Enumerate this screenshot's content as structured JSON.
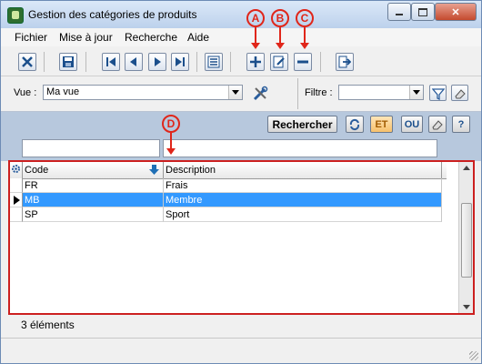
{
  "window": {
    "title": "Gestion des catégories de produits",
    "minimize_icon": "minimize-icon",
    "maximize_icon": "maximize-icon",
    "close_label": "✕"
  },
  "menu": {
    "items": [
      "Fichier",
      "Mise à jour",
      "Recherche",
      "Aide"
    ]
  },
  "toolbar": {
    "buttons": [
      "close-icon",
      "save-icon",
      "first-record-icon",
      "previous-record-icon",
      "next-record-icon",
      "last-record-icon",
      "list-icon",
      "add-icon",
      "edit-icon",
      "delete-icon",
      "export-icon"
    ]
  },
  "annotations": {
    "a": "A",
    "b": "B",
    "c": "C",
    "d": "D",
    "color": "#e0261a"
  },
  "view": {
    "label": "Vue :",
    "value": "Ma vue",
    "filter_label": "Filtre :",
    "filter_value": ""
  },
  "search": {
    "button_label": "Rechercher",
    "and_label": "ET",
    "or_label": "OU",
    "help_label": "?"
  },
  "grid": {
    "columns": [
      "Code",
      "Description"
    ],
    "rows": [
      {
        "code": "FR",
        "description": "Frais"
      },
      {
        "code": "MB",
        "description": "Membre"
      },
      {
        "code": "SP",
        "description": "Sport"
      }
    ],
    "selected_row": 1,
    "selection_color": "#3399ff",
    "border_color": "#cc2020"
  },
  "status": {
    "count_text": "3 éléments"
  }
}
